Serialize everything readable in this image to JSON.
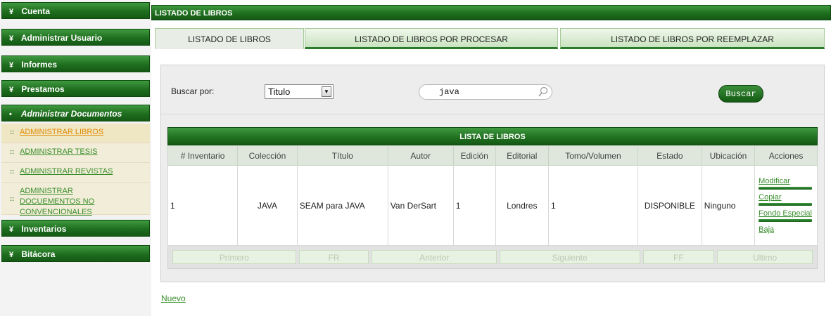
{
  "sidebar": {
    "menus": [
      {
        "label": "Cuenta",
        "chev": "¥"
      },
      {
        "label": "Administrar Usuario",
        "chev": "¥"
      },
      {
        "label": "Informes",
        "chev": "¥"
      },
      {
        "label": "Prestamos",
        "chev": "¥"
      },
      {
        "label": "Administrar Documentos",
        "chev": "•"
      },
      {
        "label": "Inventarios",
        "chev": "¥"
      },
      {
        "label": "Bitácora",
        "chev": "¥"
      }
    ],
    "subitems": [
      {
        "label": "ADMINISTRAR LIBROS"
      },
      {
        "label": "ADMINISTRAR TESIS"
      },
      {
        "label": "ADMINISTRAR REVISTAS"
      },
      {
        "label": "ADMINISTRAR DOCUEMENTOS NO CONVENCIONALES"
      }
    ],
    "bullet": "::"
  },
  "main": {
    "title": "LISTADO DE LIBROS",
    "tabs": [
      {
        "label": "LISTADO DE LIBROS"
      },
      {
        "label": "LISTADO DE LIBROS POR PROCESAR"
      },
      {
        "label": "LISTADO DE LIBROS POR REEMPLAZAR"
      }
    ]
  },
  "search": {
    "label": "Buscar por:",
    "field_value": "Titulo",
    "query": "java",
    "button": "Buscar"
  },
  "table": {
    "title": "LISTA DE LIBROS",
    "columns": [
      "# Inventario",
      "Colección",
      "Título",
      "Autor",
      "Edición",
      "Editorial",
      "Tomo/Volumen",
      "Estado",
      "Ubicación",
      "Acciones"
    ],
    "rows": [
      {
        "inventario": "1",
        "coleccion": "JAVA",
        "titulo": "SEAM para JAVA",
        "autor": "Van DerSart",
        "edicion": "1",
        "editorial": "Londres",
        "tomo": "1",
        "estado": "DISPONIBLE",
        "ubicacion": "Ninguno",
        "acciones": [
          "Modificar",
          "Copiar",
          "Fondo Especial",
          "Baja"
        ]
      }
    ]
  },
  "pager": [
    "Primero",
    "FR",
    "Anterior",
    "Siguiente",
    "FF",
    "Ultimo"
  ],
  "footer": {
    "nuevo": "Nuevo"
  },
  "colors": {
    "accent_green": "#1f6e1f",
    "link_green": "#3a8e2c",
    "active_link": "#e08a00"
  }
}
